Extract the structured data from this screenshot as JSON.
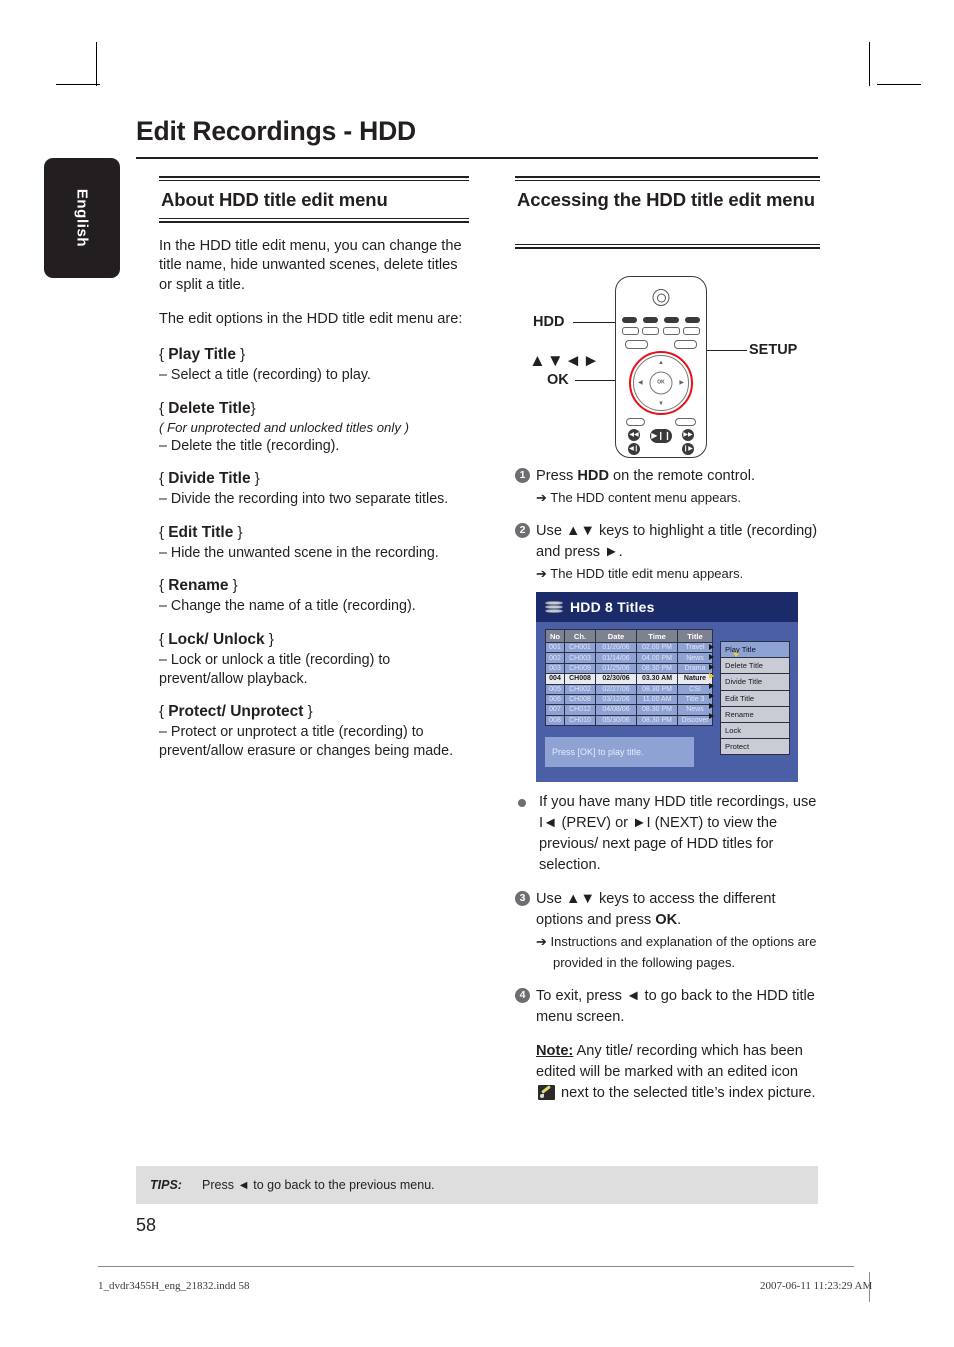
{
  "page_title": "Edit Recordings - HDD",
  "language_tab": "English",
  "left_column": {
    "section_title": "About HDD title edit menu",
    "intro_1": "In the HDD title edit menu, you can change the title name, hide unwanted scenes, delete titles or split a title.",
    "intro_2": "The edit options in the HDD title edit menu are:",
    "options": [
      {
        "open": "{ ",
        "name": "Play Title",
        "close": " }",
        "note": "",
        "desc": "–  Select a title (recording) to play."
      },
      {
        "open": "{ ",
        "name": "Delete Title",
        "close": "}",
        "note": "( For unprotected and unlocked titles only )",
        "desc": "–  Delete the title (recording)."
      },
      {
        "open": "{ ",
        "name": "Divide Title",
        "close": " }",
        "note": "",
        "desc": "–  Divide the recording into two separate titles."
      },
      {
        "open": "{ ",
        "name": "Edit Title",
        "close": " }",
        "note": "",
        "desc": "–  Hide the unwanted scene in the recording."
      },
      {
        "open": "{ ",
        "name": "Rename",
        "close": " }",
        "note": "",
        "desc": "–  Change the name of a title (recording)."
      },
      {
        "open": "{ ",
        "name": "Lock/ Unlock",
        "close": " }",
        "note": "",
        "desc": "–  Lock or unlock a title (recording) to prevent/allow playback."
      },
      {
        "open": "{ ",
        "name": "Protect/ Unprotect",
        "close": " }",
        "note": "",
        "desc": "–  Protect or unprotect a title (recording) to prevent/allow erasure or changes being made."
      }
    ]
  },
  "right_column": {
    "section_title": "Accessing the HDD title edit menu",
    "remote_labels": {
      "hdd": "HDD",
      "setup": "SETUP",
      "nav": "▲▼◄►",
      "ok": "OK",
      "ok_button": "OK"
    },
    "steps": [
      {
        "num": "1",
        "main_pre": "Press ",
        "main_bold": "HDD",
        "main_post": " on the remote control.",
        "sub": "➔ The HDD content menu appears."
      },
      {
        "num": "2",
        "main_pre": "Use ",
        "main_bold": "▲▼",
        "main_post": " keys to highlight a title (recording) and press ►.",
        "sub": "➔ The HDD title edit menu appears."
      },
      {
        "num": "3",
        "main_pre": "Use ",
        "main_bold": "▲▼",
        "main_post": " keys to access the different options and press ",
        "main_bold2": "OK",
        "main_post2": ".",
        "sub": "➔ Instructions and explanation of the options are provided in the following pages."
      },
      {
        "num": "4",
        "main_pre": "To exit, press ◄ to go back to the HDD title menu screen.",
        "main_bold": "",
        "main_post": "",
        "sub": ""
      }
    ],
    "bullet": "If you have many HDD title recordings, use I◄ (PREV) or  ►I (NEXT) to view the previous/ next page of HDD titles for selection.",
    "note_label": "Note:",
    "note_pre": " Any title/ recording which has been edited will be marked with an edited icon ",
    "note_post": " next to the selected title’s index picture."
  },
  "osd": {
    "title": "HDD 8 Titles",
    "columns": [
      "No",
      "Ch.",
      "Date",
      "Time",
      "Title"
    ],
    "rows": [
      {
        "no": "001",
        "ch": "CH001",
        "date": "01/20/06",
        "time": "02.00 PM",
        "title": "Travel",
        "selected": false
      },
      {
        "no": "002",
        "ch": "CH003",
        "date": "01/14/06",
        "time": "04.00 PM",
        "title": "News",
        "selected": false
      },
      {
        "no": "003",
        "ch": "CH009",
        "date": "01/25/06",
        "time": "08.30 PM",
        "title": "Drama",
        "selected": false
      },
      {
        "no": "004",
        "ch": "CH008",
        "date": "02/30/06",
        "time": "03.30 AM",
        "title": "Nature",
        "selected": true
      },
      {
        "no": "005",
        "ch": "CH002",
        "date": "02/27/06",
        "time": "08.30 PM",
        "title": "CSI",
        "selected": false
      },
      {
        "no": "006",
        "ch": "CH008",
        "date": "03/12/06",
        "time": "11.00 AM",
        "title": "Title 3",
        "selected": false
      },
      {
        "no": "007",
        "ch": "CH012",
        "date": "04/08/06",
        "time": "08.30 PM",
        "title": "News",
        "selected": false
      },
      {
        "no": "008",
        "ch": "CH010",
        "date": "05/30/06",
        "time": "08.30 PM",
        "title": "Discover",
        "selected": false
      }
    ],
    "menu": [
      "Play Title",
      "Delete Title",
      "Divide Title",
      "Edit Title",
      "Rename",
      "Lock",
      "Protect"
    ],
    "menu_highlight_index": 0,
    "menu_pointer_index": 3,
    "footer_hint": "Press [OK] to play title.",
    "colors": {
      "screen_bg": "#4a5fa5",
      "titlebar": "#1b2a68",
      "row": "#8ea2d4",
      "row_selected": "#e8eaf0",
      "header": "#7e8290",
      "menu_bg": "#c9ccd4",
      "pointer": "#f2d024"
    }
  },
  "tips": {
    "label": "TIPS:",
    "text": "Press ◄ to go back to the previous menu."
  },
  "page_number": "58",
  "footer": {
    "left": "1_dvdr3455H_eng_21832.indd   58",
    "right": "2007-06-11   11:23:29 AM"
  }
}
